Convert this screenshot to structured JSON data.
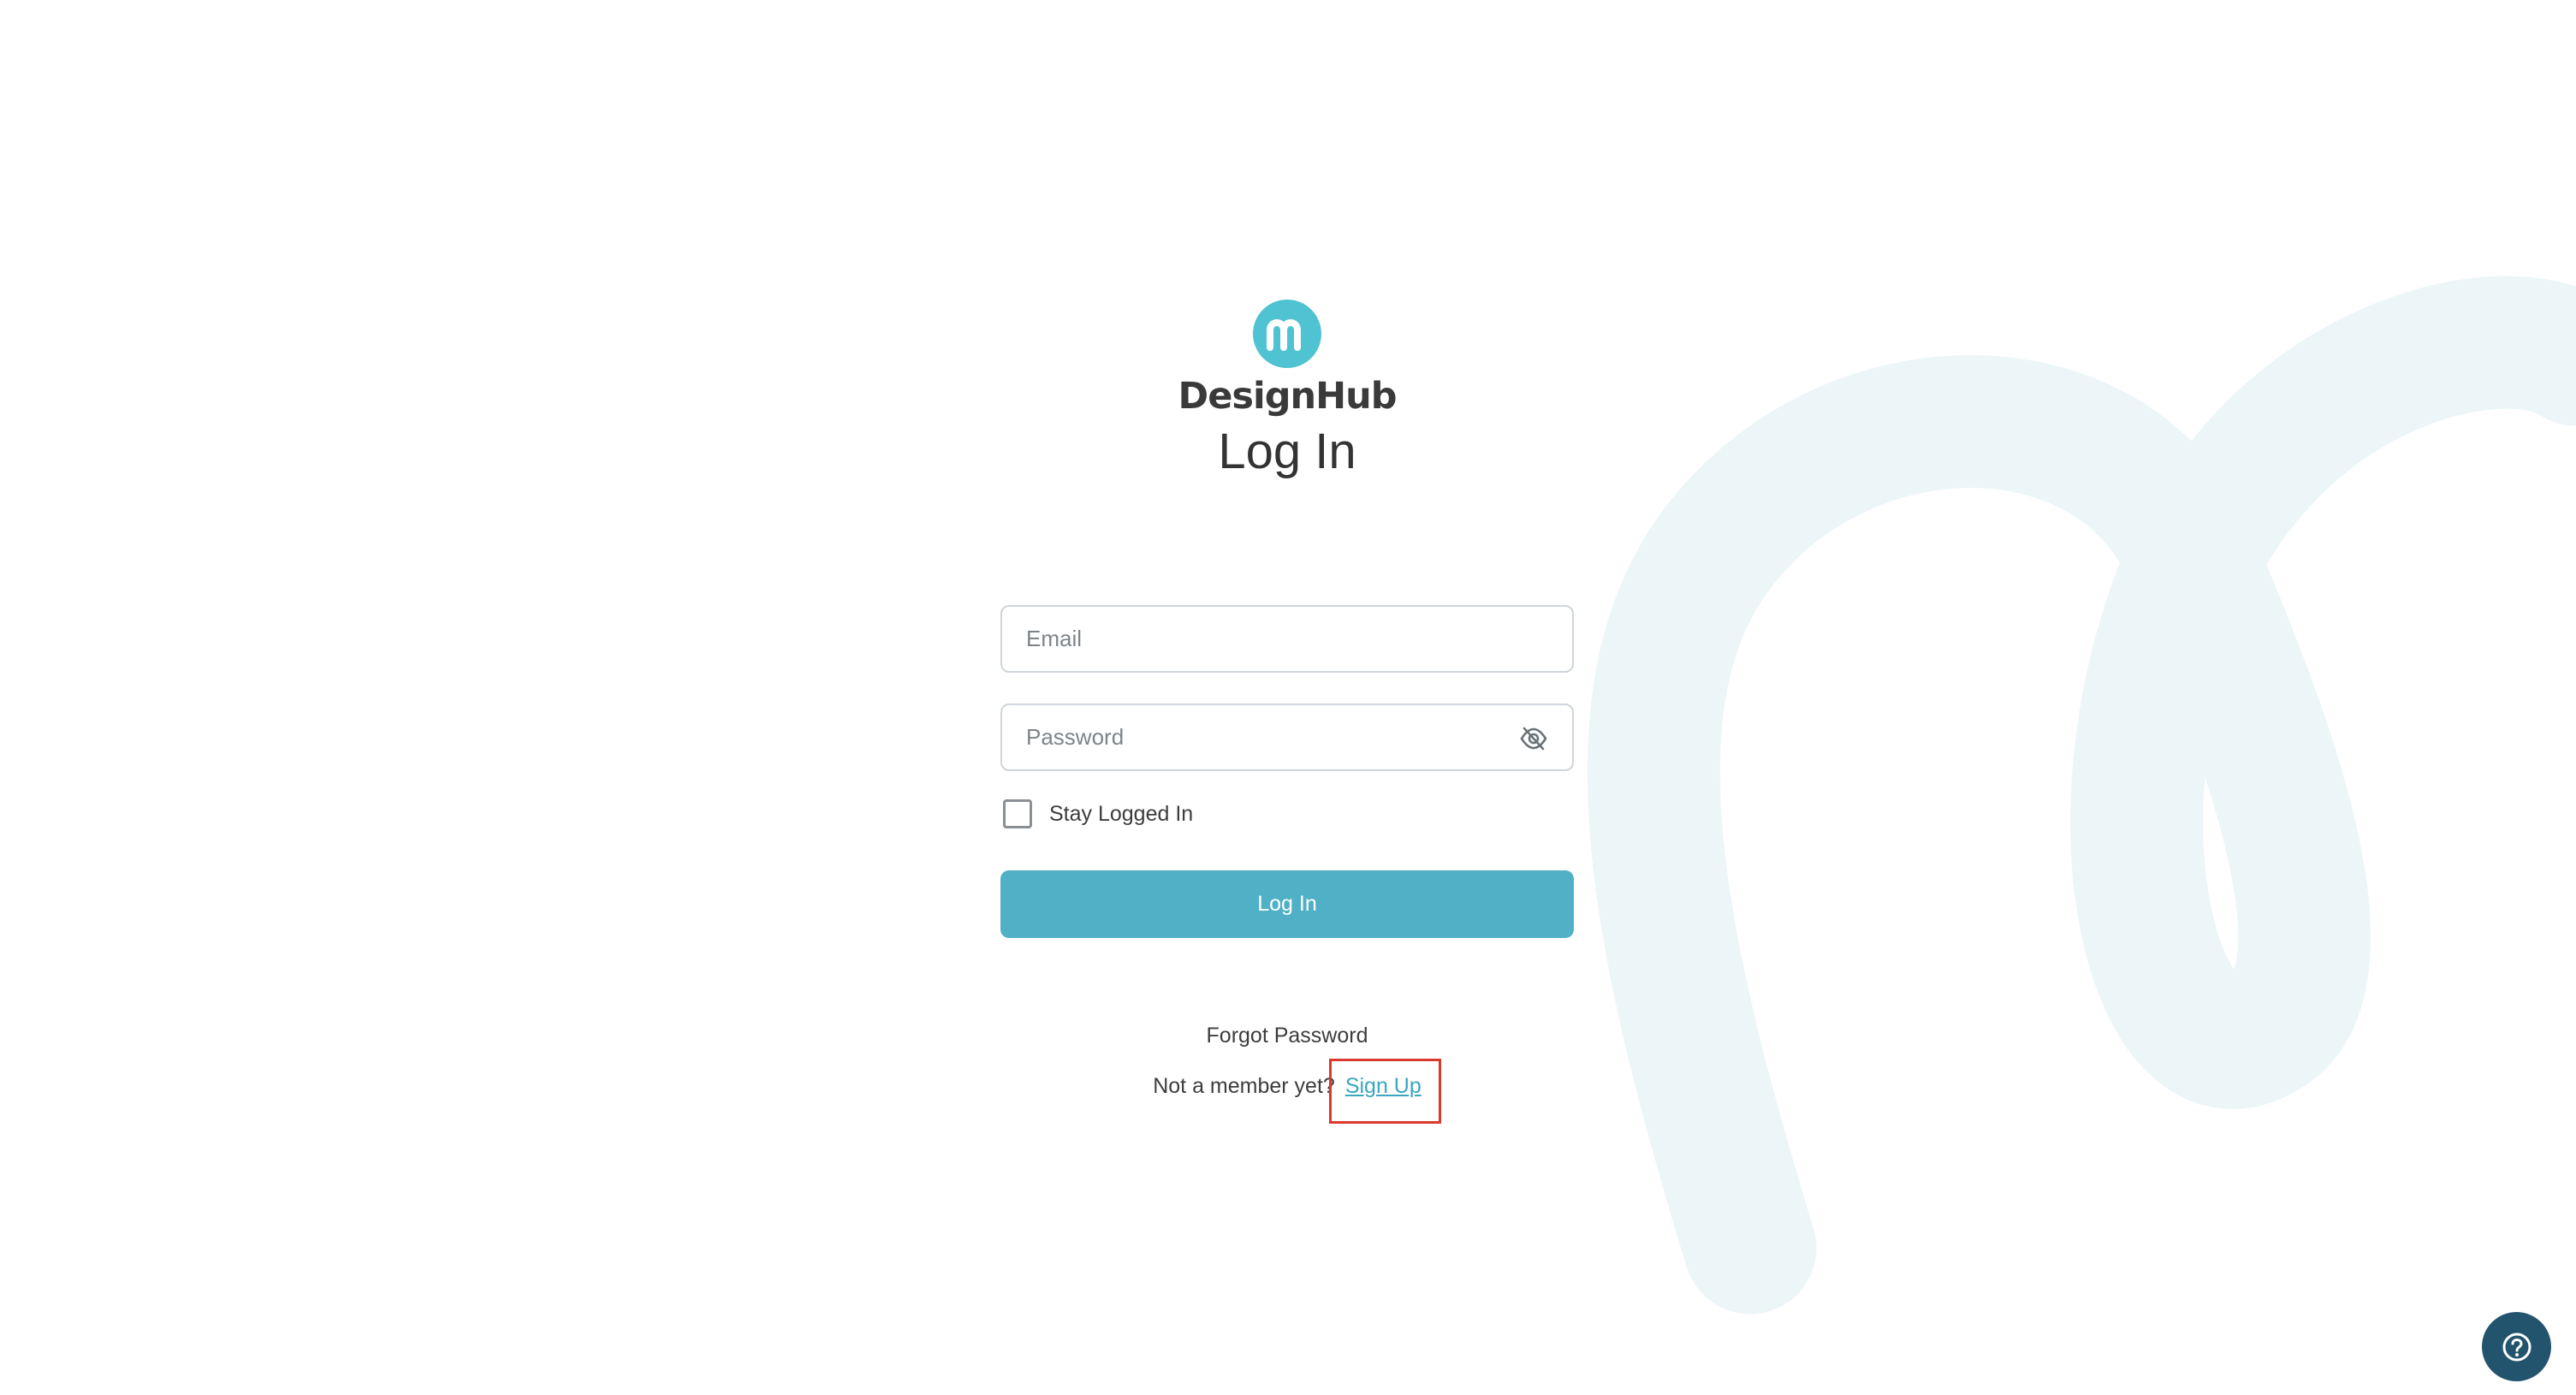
{
  "brand": {
    "name": "DesignHub",
    "logo_icon": "designhub-logo-icon",
    "accent": "#4fc3d1"
  },
  "page": {
    "title": "Log In"
  },
  "form": {
    "email": {
      "placeholder": "Email",
      "value": ""
    },
    "password": {
      "placeholder": "Password",
      "value": "",
      "toggle_icon": "eye-off-icon"
    },
    "stay_logged_in": {
      "label": "Stay Logged In",
      "checked": false
    },
    "submit_label": "Log In",
    "submit_color": "#4fb0c6"
  },
  "links": {
    "forgot_password": "Forgot Password",
    "not_member_text": "Not a member yet?",
    "sign_up": "Sign Up"
  },
  "help": {
    "icon": "help-icon",
    "color": "#23546e"
  }
}
